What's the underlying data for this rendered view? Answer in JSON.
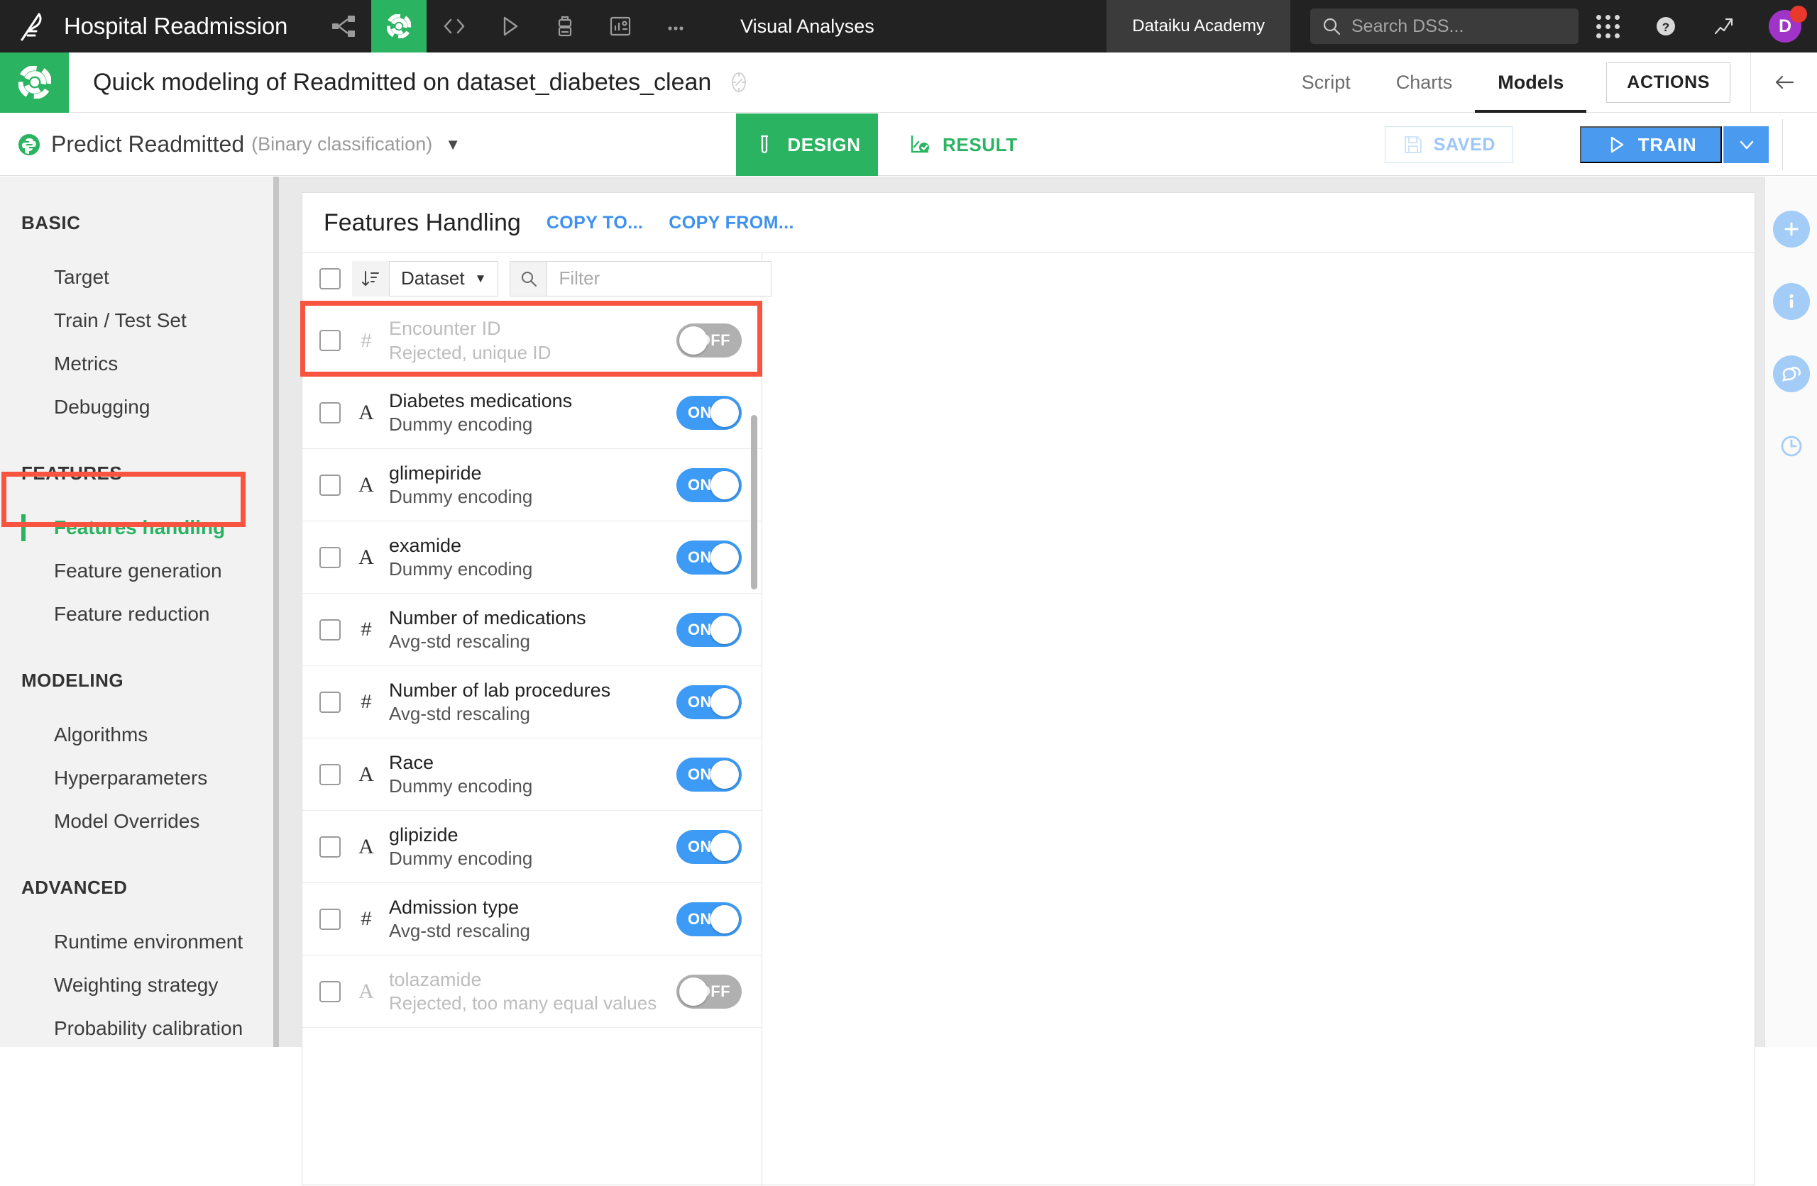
{
  "topbar": {
    "logo_icon": "dataiku-bird-logo",
    "project_name": "Hospital Readmission",
    "nav_icons": [
      {
        "name": "flow-share-icon",
        "label": "Flow"
      },
      {
        "name": "lab-icon",
        "label": "Lab",
        "active": true
      },
      {
        "name": "code-icon",
        "label": "Code"
      },
      {
        "name": "jobs-play-icon",
        "label": "Jobs"
      },
      {
        "name": "automation-icon",
        "label": "Automation"
      },
      {
        "name": "dashboard-icon",
        "label": "Dashboards"
      },
      {
        "name": "more-ellipsis-icon",
        "label": "More"
      }
    ],
    "section_label": "Visual Analyses",
    "academy_label": "Dataiku Academy",
    "search_placeholder": "Search DSS...",
    "apps_icon": "grid-apps-icon",
    "help_icon": "question-help-icon",
    "trend_icon": "trending-up-icon",
    "avatar_initial": "D"
  },
  "subheader": {
    "logo_icon": "lab-green-logo",
    "title": "Quick modeling of Readmitted on dataset_diabetes_clean",
    "badge_icon": "scope-badge-icon",
    "tabs": [
      {
        "label": "Script",
        "active": false
      },
      {
        "label": "Charts",
        "active": false
      },
      {
        "label": "Models",
        "active": true
      }
    ],
    "actions_label": "ACTIONS",
    "back_icon": "arrow-left-icon"
  },
  "modelbar": {
    "predict_icon": "python-model-icon",
    "predict_title": "Predict Readmitted",
    "predict_subtitle": "(Binary classification)",
    "caret": "▼",
    "design_tab": {
      "label": "DESIGN",
      "icon": "test-tube-icon",
      "active": true
    },
    "result_tab": {
      "label": "RESULT",
      "icon": "results-check-icon",
      "active": false
    },
    "saved_label": "SAVED",
    "saved_icon": "floppy-save-icon",
    "train_label": "TRAIN",
    "train_icon": "play-triangle-icon",
    "train_caret_icon": "chevron-down-icon"
  },
  "sidebar": {
    "groups": [
      {
        "title": "BASIC",
        "items": [
          {
            "label": "Target",
            "selected": false
          },
          {
            "label": "Train / Test Set",
            "selected": false
          },
          {
            "label": "Metrics",
            "selected": false
          },
          {
            "label": "Debugging",
            "selected": false
          }
        ]
      },
      {
        "title": "FEATURES",
        "items": [
          {
            "label": "Features handling",
            "selected": true
          },
          {
            "label": "Feature generation",
            "selected": false
          },
          {
            "label": "Feature reduction",
            "selected": false
          }
        ]
      },
      {
        "title": "MODELING",
        "items": [
          {
            "label": "Algorithms",
            "selected": false
          },
          {
            "label": "Hyperparameters",
            "selected": false
          },
          {
            "label": "Model Overrides",
            "selected": false
          }
        ]
      },
      {
        "title": "ADVANCED",
        "items": [
          {
            "label": "Runtime environment",
            "selected": false
          },
          {
            "label": "Weighting strategy",
            "selected": false
          },
          {
            "label": "Probability calibration",
            "selected": false
          }
        ]
      }
    ]
  },
  "panel": {
    "title": "Features Handling",
    "copy_to_label": "COPY TO...",
    "copy_from_label": "COPY FROM...",
    "toolbar": {
      "sort_icon": "sort-descending-icon",
      "sort_value": "Dataset",
      "sort_caret": "▼",
      "search_icon": "search-icon",
      "filter_placeholder": "Filter"
    },
    "features": [
      {
        "type": "#",
        "name": "Encounter ID",
        "desc": "Rejected, unique ID",
        "state": "OFF",
        "highlighted": true
      },
      {
        "type": "A",
        "name": "Diabetes medications",
        "desc": "Dummy encoding",
        "state": "ON",
        "highlighted": false
      },
      {
        "type": "A",
        "name": "glimepiride",
        "desc": "Dummy encoding",
        "state": "ON",
        "highlighted": false
      },
      {
        "type": "A",
        "name": "examide",
        "desc": "Dummy encoding",
        "state": "ON",
        "highlighted": false
      },
      {
        "type": "#",
        "name": "Number of medications",
        "desc": "Avg-std rescaling",
        "state": "ON",
        "highlighted": false
      },
      {
        "type": "#",
        "name": "Number of lab procedures",
        "desc": "Avg-std rescaling",
        "state": "ON",
        "highlighted": false
      },
      {
        "type": "A",
        "name": "Race",
        "desc": "Dummy encoding",
        "state": "ON",
        "highlighted": false
      },
      {
        "type": "A",
        "name": "glipizide",
        "desc": "Dummy encoding",
        "state": "ON",
        "highlighted": false
      },
      {
        "type": "#",
        "name": "Admission type",
        "desc": "Avg-std rescaling",
        "state": "ON",
        "highlighted": false
      },
      {
        "type": "A",
        "name": "tolazamide",
        "desc": "Rejected, too many equal values",
        "state": "OFF",
        "highlighted": false
      }
    ]
  },
  "rail": {
    "buttons": [
      {
        "name": "add-plus-icon"
      },
      {
        "name": "info-icon"
      },
      {
        "name": "discussions-chat-icon"
      },
      {
        "name": "history-clock-icon"
      }
    ]
  },
  "colors": {
    "brand_green": "#2ab360",
    "accent_blue": "#3d9bf5",
    "highlight_red": "#f9543f",
    "dark_header": "#222222"
  }
}
